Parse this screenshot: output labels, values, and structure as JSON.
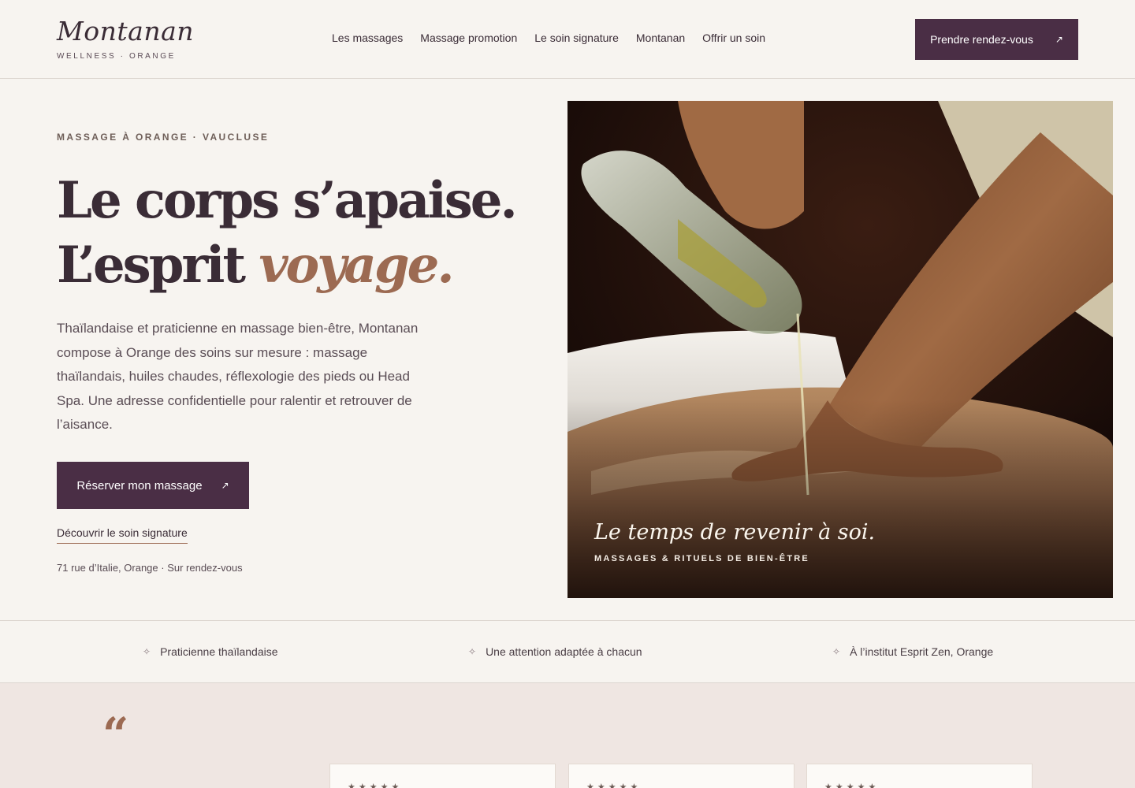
{
  "brand": {
    "name": "Montanan",
    "tagline": "WELLNESS · ORANGE"
  },
  "nav": [
    {
      "label": "Les massages"
    },
    {
      "label": "Massage promotion"
    },
    {
      "label": "Le soin signature"
    },
    {
      "label": "Montanan"
    },
    {
      "label": "Offrir un soin"
    }
  ],
  "header_cta": {
    "label": "Prendre rendez-vous",
    "icon": "↗"
  },
  "hero": {
    "eyebrow": "MASSAGE À ORANGE · VAUCLUSE",
    "headline_line1": "Le corps s’apaise.",
    "headline_line2_start": "L’esprit ",
    "headline_line2_accent": "voyage.",
    "intro": "Thaïlandaise et praticienne en massage bien-être, Montanan compose à Orange des soins sur mesure : massage thaïlandais, huiles chaudes, réflexologie des pieds ou Head Spa. Une adresse confidentielle pour ralentir et retrouver de l’aisance.",
    "cta_primary": {
      "label": "Réserver mon massage",
      "icon": "↗"
    },
    "cta_secondary": "Découvrir le soin signature",
    "address": "71 rue d’Italie, Orange · Sur rendez-vous",
    "image": {
      "icon": "massage-oil-photo",
      "caption_title": "Le temps de revenir à soi.",
      "caption_sub": "MASSAGES & RITUELS DE BIEN-ÊTRE"
    }
  },
  "features": [
    {
      "icon": "✧",
      "label": "Praticienne thaïlandaise"
    },
    {
      "icon": "✧",
      "label": "Une attention adaptée à chacun"
    },
    {
      "icon": "✧",
      "label": "À l’institut Esprit Zen, Orange"
    }
  ],
  "testimonials": {
    "quote_mark": "“",
    "cards": [
      {
        "stars": "★★★★★"
      },
      {
        "stars": "★★★★★"
      },
      {
        "stars": "★★★★★"
      }
    ]
  },
  "colors": {
    "primary": "#4a2e45",
    "accent": "#9c6a52",
    "background": "#f7f4f0",
    "testimonial_bg": "#efe6e2"
  }
}
